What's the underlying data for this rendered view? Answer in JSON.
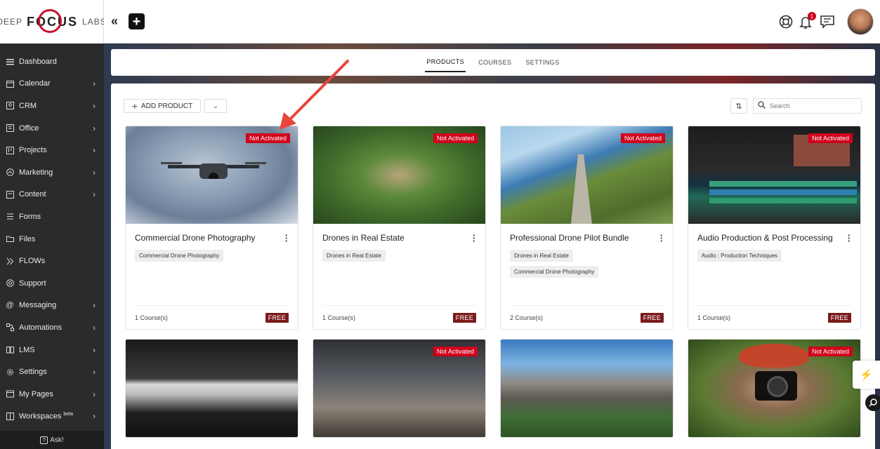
{
  "brand": {
    "deep": "DEEP",
    "focus": "FOCUS",
    "labs": "LABS",
    "accent": "#c8102e"
  },
  "sidebar": {
    "items": [
      {
        "label": "Dashboard",
        "icon": "menu-icon",
        "chevron": false
      },
      {
        "label": "Calendar",
        "icon": "calendar-icon",
        "chevron": true
      },
      {
        "label": "CRM",
        "icon": "crm-icon",
        "chevron": true
      },
      {
        "label": "Office",
        "icon": "office-icon",
        "chevron": true
      },
      {
        "label": "Projects",
        "icon": "projects-icon",
        "chevron": true
      },
      {
        "label": "Marketing",
        "icon": "marketing-icon",
        "chevron": true
      },
      {
        "label": "Content",
        "icon": "content-icon",
        "chevron": true
      },
      {
        "label": "Forms",
        "icon": "forms-icon",
        "chevron": false
      },
      {
        "label": "Files",
        "icon": "folder-icon",
        "chevron": false
      },
      {
        "label": "FLOWs",
        "icon": "flows-icon",
        "chevron": false
      },
      {
        "label": "Support",
        "icon": "support-icon",
        "chevron": false
      },
      {
        "label": "Messaging",
        "icon": "at-icon",
        "chevron": true
      },
      {
        "label": "Automations",
        "icon": "automations-icon",
        "chevron": true
      },
      {
        "label": "LMS",
        "icon": "book-icon",
        "chevron": true
      },
      {
        "label": "Settings",
        "icon": "gear-icon",
        "chevron": true
      },
      {
        "label": "My Pages",
        "icon": "pages-icon",
        "chevron": true
      },
      {
        "label": "Workspaces",
        "icon": "workspaces-icon",
        "chevron": true,
        "sup": "beta"
      }
    ],
    "ask": "Ask!"
  },
  "topbar": {
    "collapse": "«",
    "add": "+",
    "notification_count": "1"
  },
  "tabs": [
    {
      "label": "PRODUCTS",
      "active": true
    },
    {
      "label": "COURSES",
      "active": false
    },
    {
      "label": "SETTINGS",
      "active": false
    }
  ],
  "toolbar": {
    "add_product": "ADD PRODUCT",
    "search_placeholder": "Search"
  },
  "cards": [
    {
      "title": "Commercial Drone Photography",
      "status": "Not Activated",
      "tags": [
        "Commercial Drone Photography"
      ],
      "courses": "1 Course(s)",
      "price": "FREE"
    },
    {
      "title": "Drones in Real Estate",
      "status": "Not Activated",
      "tags": [
        "Drones in Real Estate"
      ],
      "courses": "1 Course(s)",
      "price": "FREE"
    },
    {
      "title": "Professional Drone Pilot Bundle",
      "status": "Not Activated",
      "tags": [
        "Drones in Real Estate",
        "Commercial Drone Photography"
      ],
      "courses": "2 Course(s)",
      "price": "FREE"
    },
    {
      "title": "Audio Production & Post Processing",
      "status": "Not Activated",
      "tags": [
        "Audio : Production Techniques"
      ],
      "courses": "1 Course(s)",
      "price": "FREE"
    },
    {
      "status": "",
      "title": ""
    },
    {
      "status": "Not Activated",
      "title": ""
    },
    {
      "status": "",
      "title": ""
    },
    {
      "status": "Not Activated",
      "title": ""
    }
  ],
  "colors": {
    "ribbon": "#d0021b",
    "free": "#7b1b1b",
    "sidebar": "#2b2b2b"
  }
}
